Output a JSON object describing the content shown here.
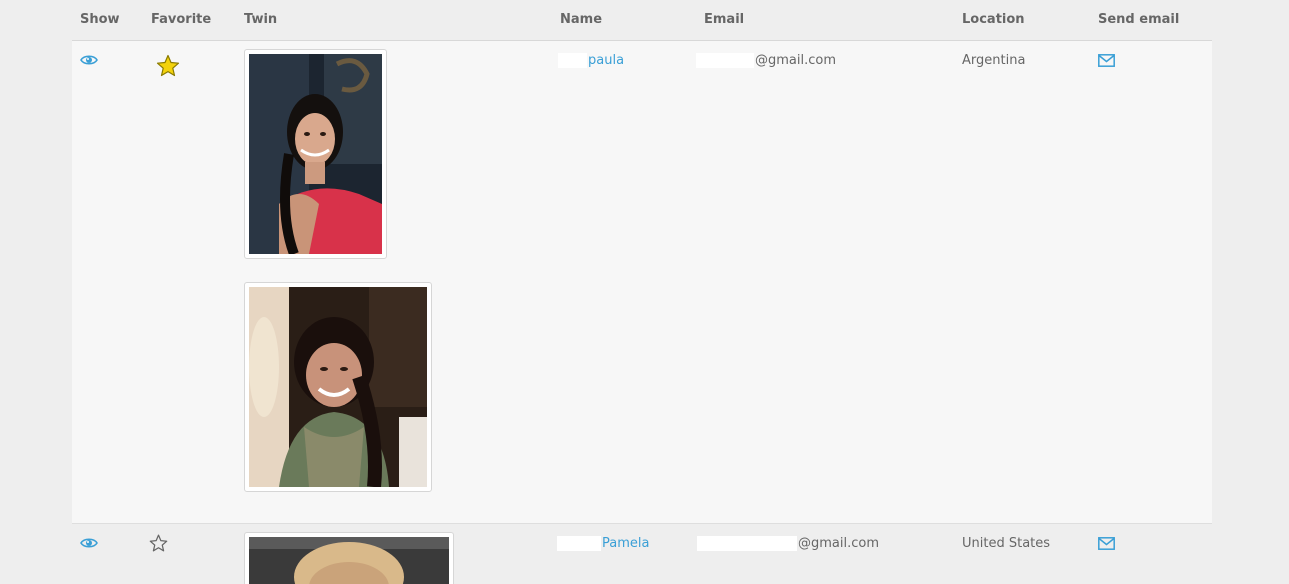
{
  "table": {
    "headers": {
      "show": "Show",
      "favorite": "Favorite",
      "twin": "Twin",
      "name": "Name",
      "email": "Email",
      "location": "Location",
      "send_email": "Send email"
    },
    "rows": [
      {
        "name": "paula",
        "email_domain": "@gmail.com",
        "location": "Argentina",
        "favorite": true,
        "photos": 2
      },
      {
        "name": "Pamela",
        "email_domain": "@gmail.com",
        "location": "United States",
        "favorite": false,
        "photos": 1
      }
    ]
  },
  "icons": {
    "show": "eye-icon",
    "favorite_on": "star-filled-icon",
    "favorite_off": "star-outline-icon",
    "send_email": "envelope-icon"
  },
  "colors": {
    "link": "#3a9fd6",
    "star_fill": "#f3d20c",
    "header_text": "#666666",
    "row_alt": "#f7f7f7",
    "page_bg": "#eeeeee"
  }
}
